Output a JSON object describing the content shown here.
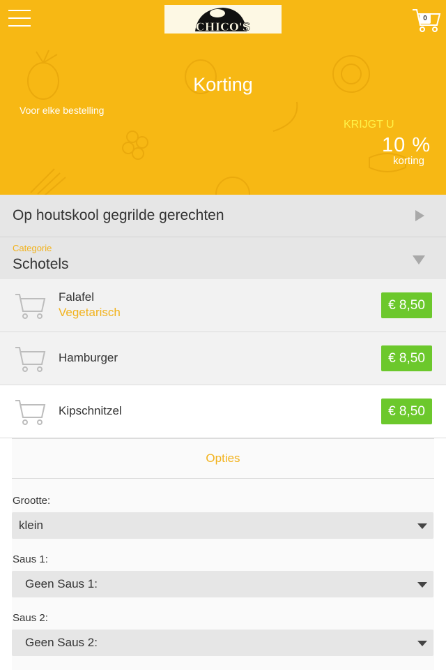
{
  "header": {
    "logo_text": "CHICO'S",
    "cart_count": "0"
  },
  "banner": {
    "title": "Korting",
    "subtitle": "Voor elke bestelling",
    "krijgt_label": "KRIJGT U",
    "percentage": "10 %",
    "korting_label": "korting"
  },
  "category_row": {
    "title": "Op houtskool gegrilde gerechten"
  },
  "category_select": {
    "label": "Categorie",
    "value": "Schotels"
  },
  "products": [
    {
      "name": "Falafel",
      "subtitle": "Vegetarisch",
      "price": "€ 8,50"
    },
    {
      "name": "Hamburger",
      "price": "€ 8,50"
    },
    {
      "name": "Kipschnitzel",
      "price": "€ 8,50"
    }
  ],
  "options": {
    "header": "Opties",
    "fields": [
      {
        "label": "Grootte:",
        "value": "klein"
      },
      {
        "label": "Saus 1:",
        "value": "Geen Saus 1:"
      },
      {
        "label": "Saus 2:",
        "value": "Geen Saus 2:"
      }
    ]
  },
  "colors": {
    "brand_yellow": "#f7b814",
    "accent_text": "#f2b21c",
    "price_green": "#6cc82c"
  }
}
